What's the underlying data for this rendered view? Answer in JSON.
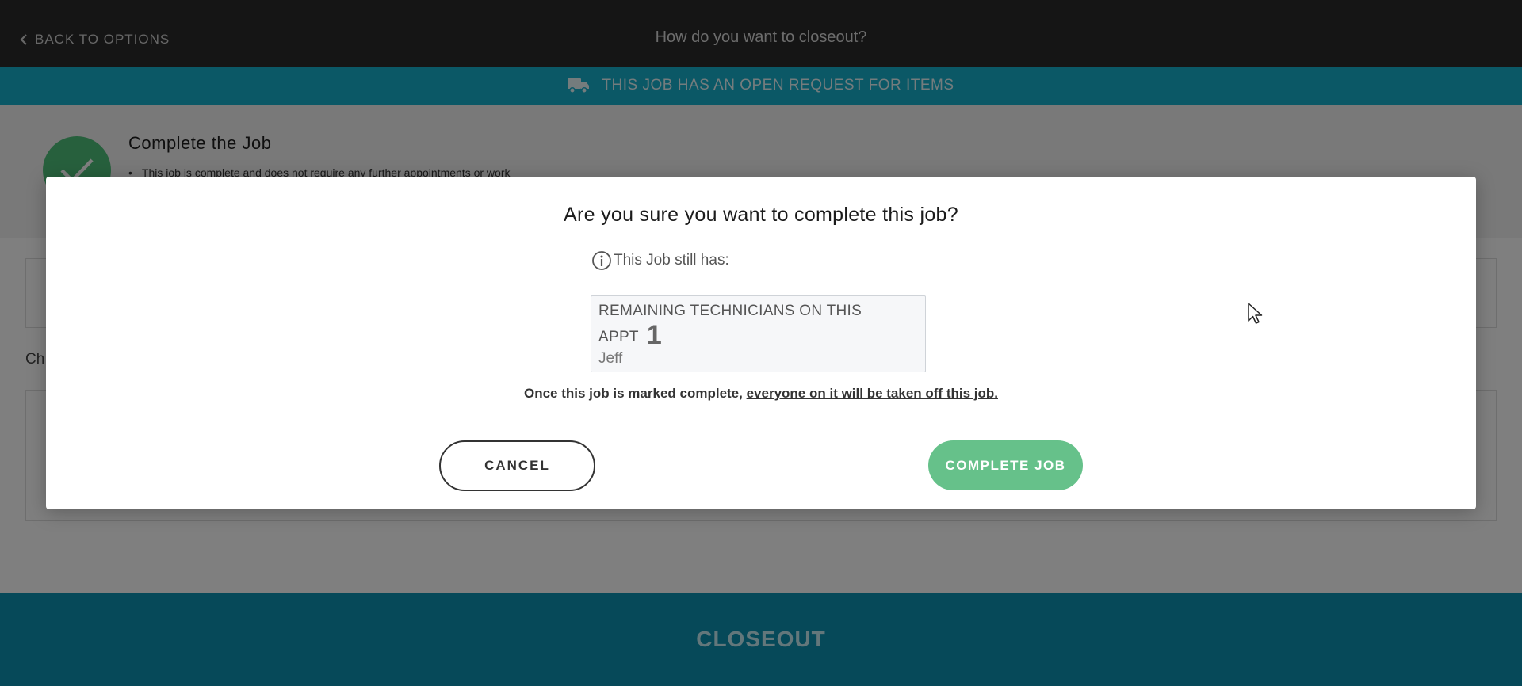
{
  "header": {
    "back_label": "BACK TO OPTIONS",
    "title": "How do you want to closeout?"
  },
  "banner": {
    "text": "THIS JOB HAS AN OPEN REQUEST FOR ITEMS",
    "icon": "truck-icon",
    "color": "#17b0cd"
  },
  "option": {
    "title": "Complete the Job",
    "bullet": "This job is complete and does not require any further appointments or work",
    "icon": "check-icon",
    "color": "#4ec07a"
  },
  "background": {
    "partial_label": "Ch"
  },
  "footer": {
    "closeout_label": "CLOSEOUT",
    "color": "#0d93b3"
  },
  "modal": {
    "title": "Are you sure you want to complete this job?",
    "info_text": "This Job still has:",
    "info_icon": "info-circle-icon",
    "technicians": {
      "heading": "REMAINING TECHNICIANS ON THIS APPT",
      "count": "1",
      "names": [
        "Jeff"
      ]
    },
    "warning_prefix": "Once this job is marked complete, ",
    "warning_link": "everyone on it will be taken off this job.",
    "cancel_label": "CANCEL",
    "complete_label": "COMPLETE JOB",
    "complete_color": "#66c18a"
  }
}
